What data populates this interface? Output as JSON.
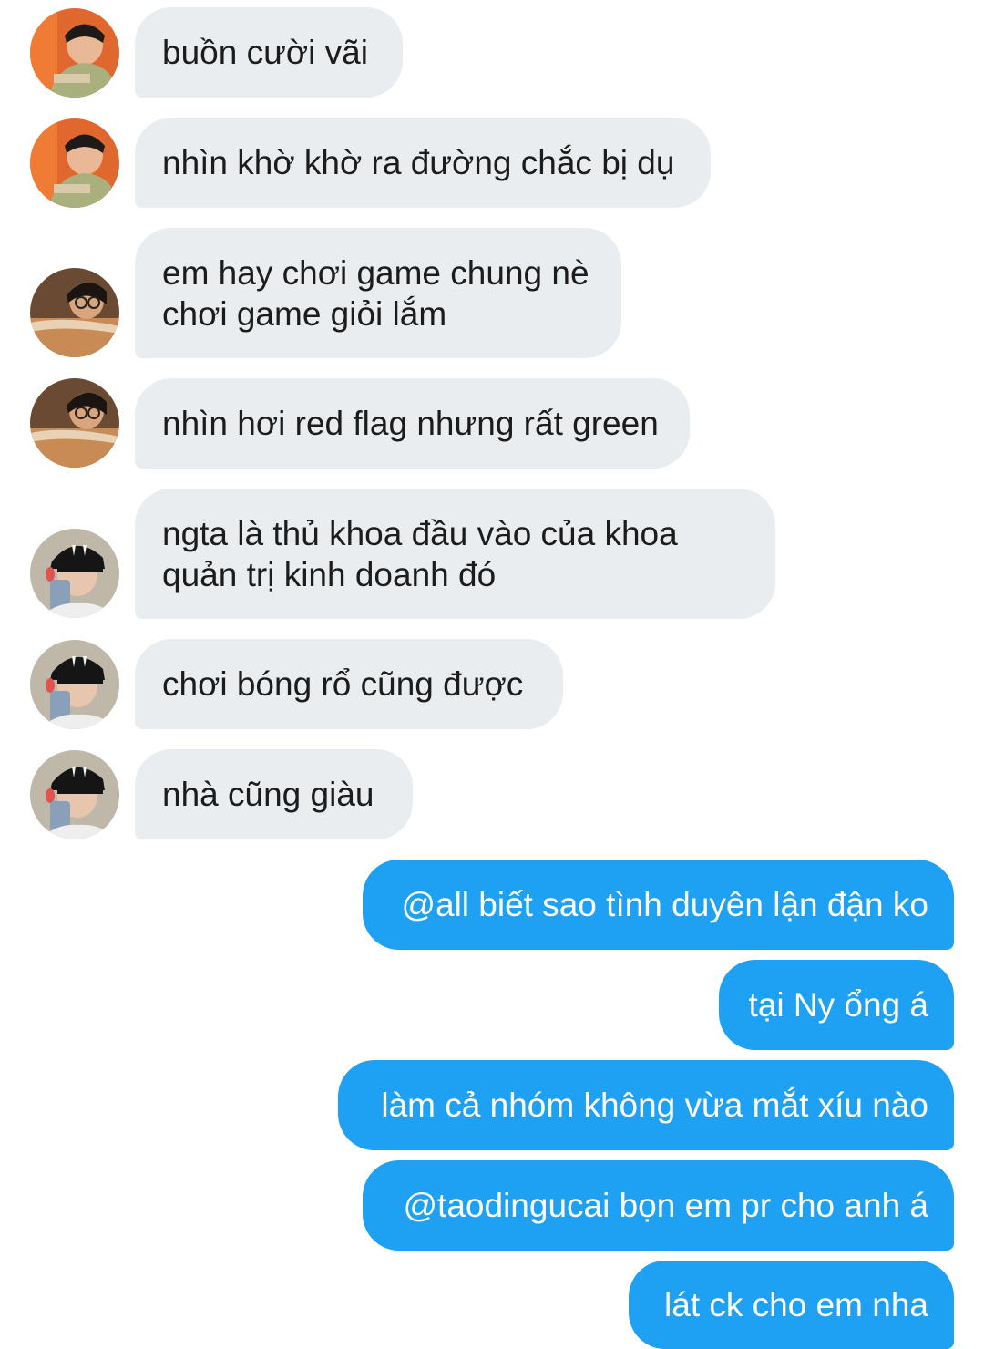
{
  "conversation": {
    "incoming": [
      {
        "text": "buồn cười vãi",
        "avatar": "user-a-avatar"
      },
      {
        "text": "nhìn khờ khờ ra đường chắc bị dụ",
        "avatar": "user-a-avatar"
      },
      {
        "text": "em hay chơi game chung nè\nchơi game giỏi lắm",
        "avatar": "user-b-avatar"
      },
      {
        "text": "nhìn hơi red flag nhưng rất green",
        "avatar": "user-b-avatar"
      },
      {
        "text": "ngta là thủ khoa đầu vào của khoa\nquản trị kinh doanh đó",
        "avatar": "user-c-avatar"
      },
      {
        "text": "chơi bóng rổ cũng được",
        "avatar": "user-c-avatar"
      },
      {
        "text": "nhà cũng giàu",
        "avatar": "user-c-avatar"
      }
    ],
    "outgoing": [
      {
        "text": "@all biết sao tình duyên lận đận ko"
      },
      {
        "text": "tại Ny ổng á"
      },
      {
        "text": "làm cả nhóm không vừa mắt xíu nào"
      },
      {
        "text": "@taodingucai bọn em pr cho anh á"
      },
      {
        "text": "lát ck cho em nha"
      }
    ]
  },
  "colors": {
    "incoming_bubble": "#e9edf0",
    "outgoing_bubble": "#1ea1f2",
    "background": "#ffffff"
  }
}
